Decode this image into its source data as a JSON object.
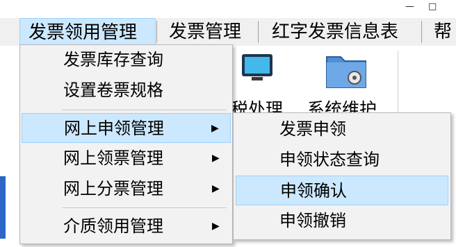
{
  "window": {
    "minimize_glyph": "—",
    "maximize_glyph": "□"
  },
  "menubar": {
    "items": [
      "发票领用管理",
      "发票管理",
      "红字发票信息表",
      "帮"
    ]
  },
  "toolbar": {
    "items": [
      {
        "label": "税处理",
        "icon": "monitor-icon"
      },
      {
        "label": "系统维护",
        "icon": "folder-gear-icon"
      }
    ]
  },
  "menu": {
    "items": [
      {
        "label": "发票库存查询"
      },
      {
        "label": "设置卷票规格"
      },
      {
        "label": "网上申领管理",
        "arrow": "▶"
      },
      {
        "label": "网上领票管理",
        "arrow": "▶"
      },
      {
        "label": "网上分票管理",
        "arrow": "▶"
      },
      {
        "label": "介质领用管理",
        "arrow": "▶"
      }
    ]
  },
  "submenu": {
    "items": [
      {
        "label": "发票申领"
      },
      {
        "label": "申领状态查询"
      },
      {
        "label": "申领确认"
      },
      {
        "label": "申领撤销"
      }
    ]
  },
  "colors": {
    "highlight": "#cce8ff",
    "highlight_border": "#99d1ff",
    "menu_bg": "#f2f2f2"
  }
}
